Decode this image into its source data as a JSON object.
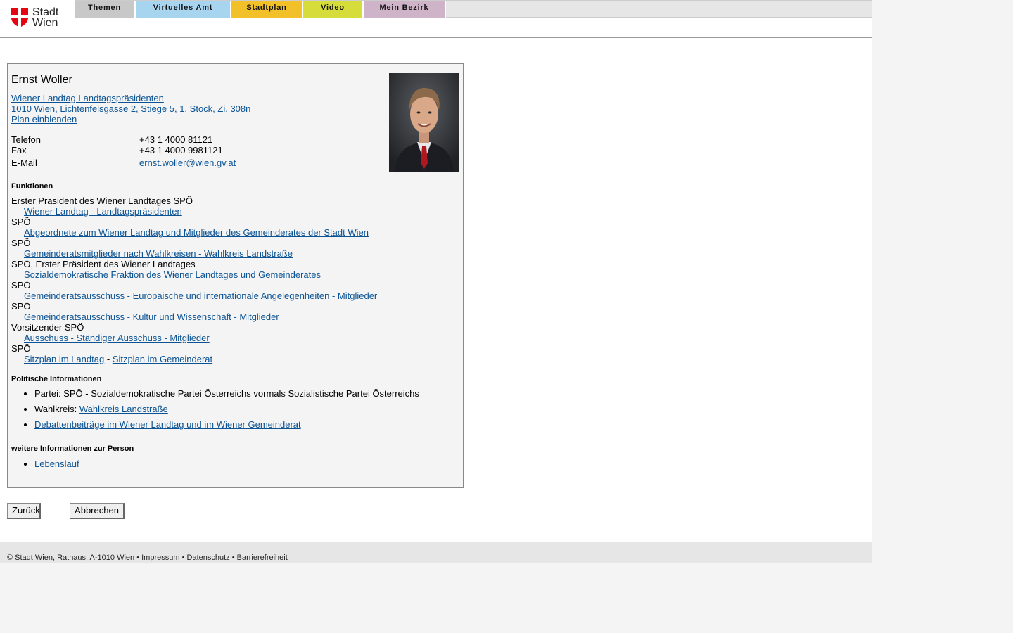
{
  "header": {
    "logo": {
      "line1": "Stadt",
      "line2": "Wien"
    },
    "tabs": [
      {
        "label": "Themen",
        "color": "#c8c8c8"
      },
      {
        "label": "Virtuelles Amt",
        "color": "#a7d5ef"
      },
      {
        "label": "Stadtplan",
        "color": "#f2c12a"
      },
      {
        "label": "Video",
        "color": "#d6dc39"
      },
      {
        "label": "Mein Bezirk",
        "color": "#cfb3c8"
      }
    ]
  },
  "person": {
    "name": "Ernst Woller",
    "org_link": "Wiener Landtag Landtagspräsidenten",
    "address_link": "1010 Wien, Lichtenfelsgasse 2, Stiege 5, 1. Stock, Zi. 308n",
    "map_link": "Plan einblenden",
    "contact": [
      {
        "label": "Telefon",
        "value": "+43 1 4000 81121"
      },
      {
        "label": "Fax",
        "value": "+43 1 4000 9981121"
      },
      {
        "label": "E-Mail",
        "value": "ernst.woller@wien.gv.at"
      }
    ]
  },
  "funktionen": {
    "heading": "Funktionen",
    "entries": [
      {
        "role": "Erster Präsident des Wiener Landtages SPÖ",
        "link": "Wiener Landtag - Landtagspräsidenten"
      },
      {
        "role": "SPÖ",
        "link": "Abgeordnete zum Wiener Landtag und Mitglieder des Gemeinderates der Stadt Wien"
      },
      {
        "role": "SPÖ",
        "link": "Gemeinderatsmitglieder nach Wahlkreisen - Wahlkreis Landstraße"
      },
      {
        "role": "SPÖ, Erster Präsident des Wiener Landtages",
        "link": "Sozialdemokratische Fraktion des Wiener Landtages und Gemeinderates"
      },
      {
        "role": "SPÖ",
        "link": "Gemeinderatsausschuss - Europäische und internationale Angelegenheiten - Mitglieder"
      },
      {
        "role": "SPÖ",
        "link": "Gemeinderatsausschuss - Kultur und Wissenschaft - Mitglieder"
      },
      {
        "role": "Vorsitzender SPÖ",
        "link": "Ausschuss - Ständiger Ausschuss - Mitglieder"
      },
      {
        "role": "SPÖ",
        "link": ""
      }
    ],
    "sitzplan": {
      "landtag": "Sitzplan im Landtag",
      "separator": "-",
      "gemeinderat": "Sitzplan im Gemeinderat"
    }
  },
  "politisch": {
    "heading": "Politische Informationen",
    "partei": "Partei: SPÖ - Sozialdemokratische Partei Österreichs vormals Sozialistische Partei Österreichs",
    "wahlkreis_label": "Wahlkreis:",
    "wahlkreis_link": "Wahlkreis Landstraße",
    "debatten_link": "Debattenbeiträge im Wiener Landtag und im Wiener Gemeinderat"
  },
  "weitere": {
    "heading": "weitere Informationen zur Person",
    "lebenslauf": "Lebenslauf"
  },
  "buttons": {
    "back": "Zurück",
    "cancel": "Abbrechen"
  },
  "footer": {
    "copyright": "© Stadt Wien, Rathaus, A-1010 Wien",
    "sep": "•",
    "impressum": "Impressum",
    "datenschutz": "Datenschutz",
    "barrierefreiheit": "Barrierefreiheit"
  }
}
